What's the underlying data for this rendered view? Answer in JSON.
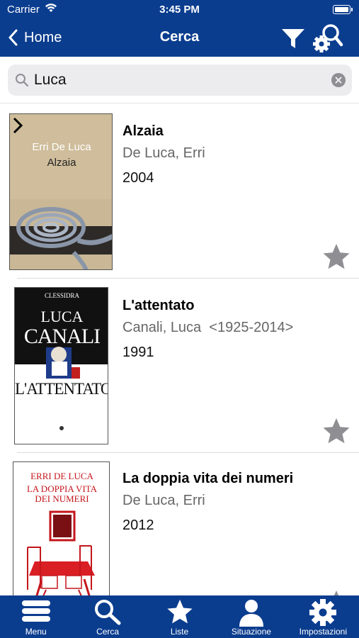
{
  "status_bar": {
    "carrier": "Carrier",
    "time": "3:45 PM"
  },
  "nav": {
    "back_label": "Home",
    "title": "Cerca"
  },
  "search": {
    "value": "Luca"
  },
  "results": [
    {
      "title": "Alzaia",
      "author": "De Luca, Erri",
      "year": "2004",
      "cover": {
        "author": "Erri De Luca",
        "title": "Alzaia"
      }
    },
    {
      "title": "L'attentato",
      "author": "Canali, Luca  <1925-2014>",
      "year": "1991",
      "cover": {
        "series": "CLESSIDRA",
        "line1": "LUCA",
        "line2": "CANALI",
        "title": "L'ATTENTATO"
      }
    },
    {
      "title": "La doppia vita dei numeri",
      "author": "De Luca, Erri",
      "year": "2012",
      "cover": {
        "author": "ERRI DE LUCA",
        "title1": "LA DOPPIA VITA",
        "title2": "DEI NUMERI"
      }
    }
  ],
  "tabbar": [
    {
      "label": "Menu",
      "icon": "menu-icon"
    },
    {
      "label": "Cerca",
      "icon": "search-icon"
    },
    {
      "label": "Liste",
      "icon": "star-icon"
    },
    {
      "label": "Situazione",
      "icon": "user-icon"
    },
    {
      "label": "Impostazioni",
      "icon": "gear-icon"
    }
  ],
  "colors": {
    "header_bg": "#0b3d8f",
    "star": "#8e8e93",
    "search_bg": "#ececee"
  }
}
